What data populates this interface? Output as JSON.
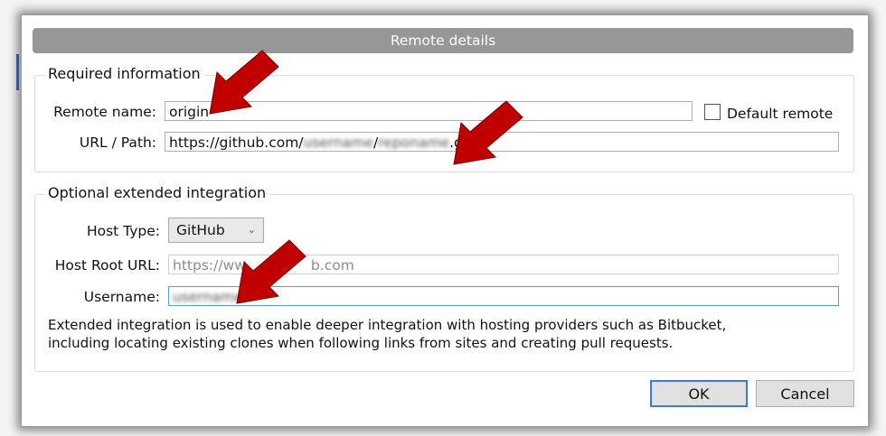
{
  "dialog": {
    "title": "Remote details",
    "required": {
      "legend": "Required information",
      "remote_name_label": "Remote name:",
      "remote_name_value": "origin",
      "default_remote_label": "Default remote",
      "url_label": "URL / Path:",
      "url_prefix": "https://github.com/",
      "url_blur1": "username",
      "url_sep": "/",
      "url_blur2": "reponame",
      "url_suffix": ".git"
    },
    "optional": {
      "legend": "Optional extended integration",
      "host_type_label": "Host Type:",
      "host_type_value": "GitHub",
      "host_root_label": "Host Root URL:",
      "host_root_value_a": "https://ww",
      "host_root_value_b": "b.com",
      "username_label": "Username:",
      "username_blur": "username",
      "note_line1": "Extended integration is used to enable deeper integration with hosting providers such as Bitbucket,",
      "note_line2": "including locating existing clones when following links from sites and creating pull requests."
    },
    "buttons": {
      "ok": "OK",
      "cancel": "Cancel"
    }
  },
  "colors": {
    "arrow": "#c00000",
    "titlebar": "#979797",
    "focus": "#3a7bd5"
  },
  "icons": {
    "dropdown": "chevron-down-icon",
    "annotation": "arrow-icon"
  }
}
